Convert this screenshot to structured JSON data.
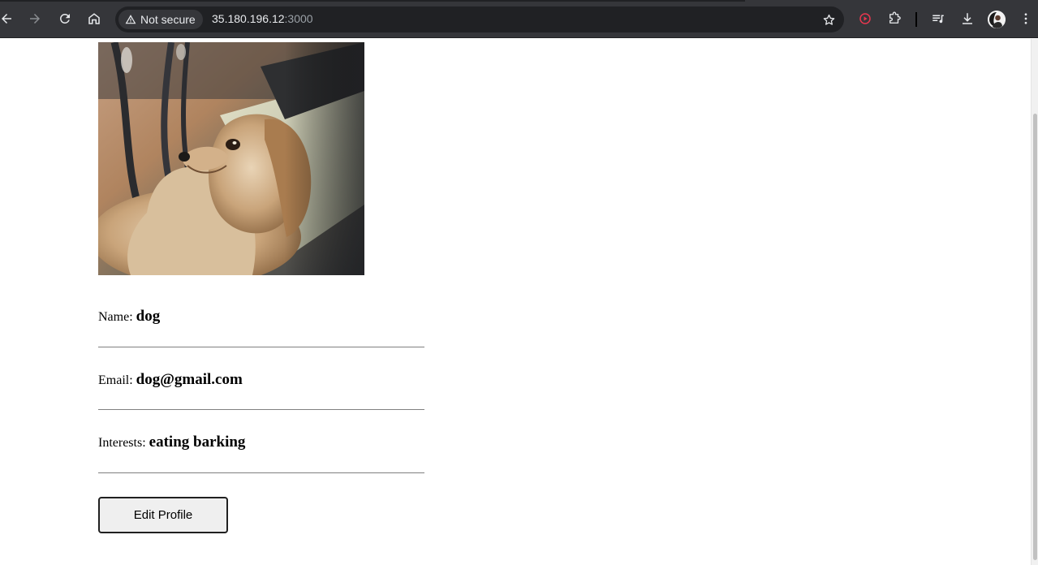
{
  "browser": {
    "security_label": "Not secure",
    "url_host": "35.180.196.12",
    "url_port": ":3000",
    "icons": [
      "back-icon",
      "forward-icon",
      "reload-icon",
      "home-icon",
      "warning-icon",
      "bookmark-star-icon",
      "record-icon",
      "extensions-icon",
      "media-queue-icon",
      "download-icon",
      "profile-avatar",
      "menu-icon"
    ]
  },
  "profile": {
    "photo_subject": "dog",
    "name_label": "Name:",
    "name_value": "dog",
    "email_label": "Email:",
    "email_value": "dog@gmail.com",
    "interests_label": "Interests:",
    "interests_value": "eating barking",
    "edit_button_label": "Edit Profile"
  },
  "colors": {
    "toolbar_bg": "#35363a",
    "omnibox_bg": "#202124",
    "record_icon": "#e8374f",
    "button_bg": "#efefef",
    "divider": "#808080"
  }
}
